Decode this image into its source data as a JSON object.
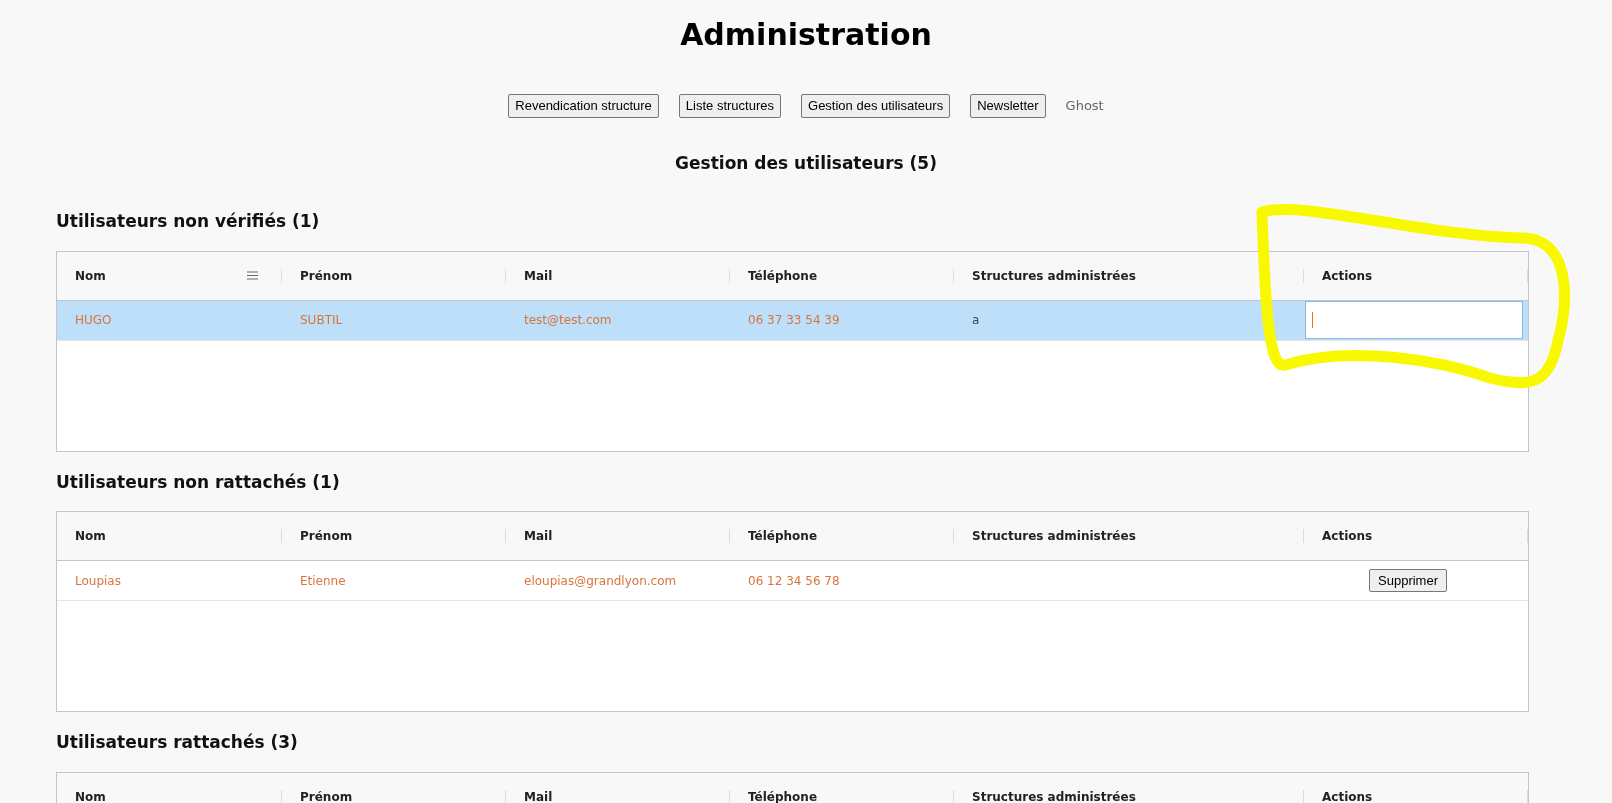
{
  "page": {
    "title": "Administration"
  },
  "nav": [
    {
      "kind": "button",
      "label": "Revendication structure"
    },
    {
      "kind": "button",
      "label": "Liste structures"
    },
    {
      "kind": "button",
      "label": "Gestion des utilisateurs"
    },
    {
      "kind": "button",
      "label": "Newsletter"
    },
    {
      "kind": "link",
      "label": "Ghost"
    }
  ],
  "heading": "Gestion des utilisateurs (5)",
  "sections": [
    {
      "title": "Utilisateurs non vérifiés (1)",
      "columns": [
        {
          "label": "Nom",
          "menu": true
        },
        {
          "label": "Prénom",
          "menu": false
        },
        {
          "label": "Mail",
          "menu": false
        },
        {
          "label": "Téléphone",
          "menu": false
        },
        {
          "label": "Structures administrées",
          "menu": false
        },
        {
          "label": "Actions",
          "menu": false
        }
      ],
      "rows": [
        {
          "selected": true,
          "cells": [
            "HUGO",
            "SUBTIL",
            "test@test.com",
            "06 37 33 54 39",
            "a"
          ],
          "action": {
            "kind": "input",
            "focused": true
          }
        }
      ]
    },
    {
      "title": "Utilisateurs non rattachés (1)",
      "columns": [
        {
          "label": "Nom",
          "menu": false
        },
        {
          "label": "Prénom",
          "menu": false
        },
        {
          "label": "Mail",
          "menu": false
        },
        {
          "label": "Téléphone",
          "menu": false
        },
        {
          "label": "Structures administrées",
          "menu": false
        },
        {
          "label": "Actions",
          "menu": false
        }
      ],
      "rows": [
        {
          "selected": false,
          "cells": [
            "Loupias",
            "Etienne",
            "eloupias@grandlyon.com",
            "06 12 34 56 78",
            null
          ],
          "action": {
            "kind": "button",
            "label": "Supprimer"
          }
        }
      ]
    },
    {
      "title": "Utilisateurs rattachés (3)",
      "columns": [
        {
          "label": "Nom",
          "menu": false
        },
        {
          "label": "Prénom",
          "menu": false
        },
        {
          "label": "Mail",
          "menu": false
        },
        {
          "label": "Téléphone",
          "menu": false
        },
        {
          "label": "Structures administrées",
          "menu": false
        },
        {
          "label": "Actions",
          "menu": false
        }
      ]
    }
  ]
}
